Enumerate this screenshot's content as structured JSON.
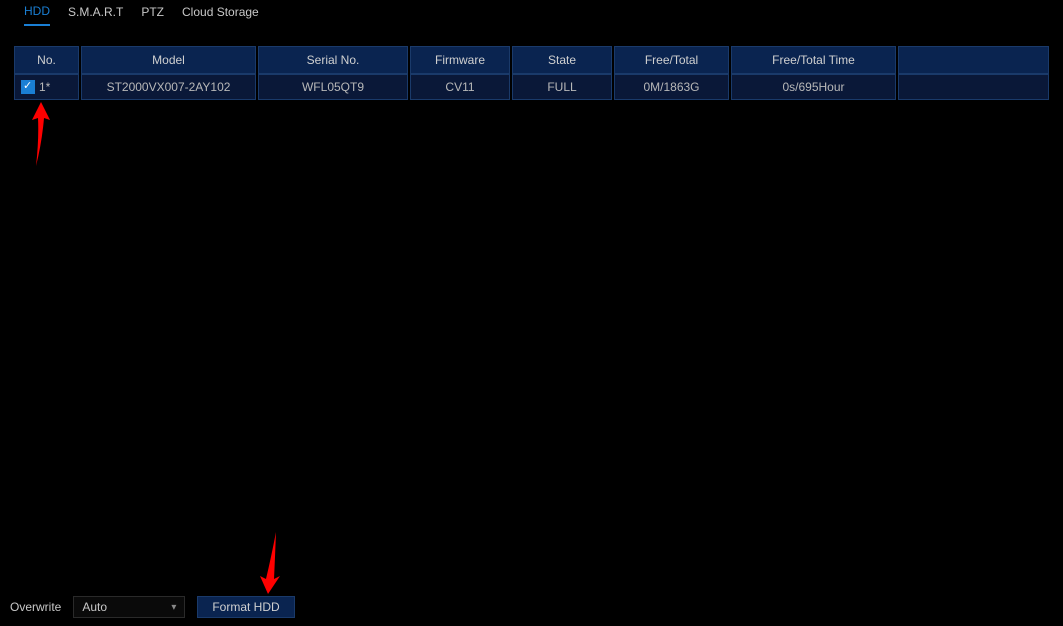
{
  "tabs": [
    {
      "label": "HDD",
      "active": true
    },
    {
      "label": "S.M.A.R.T",
      "active": false
    },
    {
      "label": "PTZ",
      "active": false
    },
    {
      "label": "Cloud Storage",
      "active": false
    }
  ],
  "table": {
    "headers": {
      "no": "No.",
      "model": "Model",
      "serial": "Serial No.",
      "firmware": "Firmware",
      "state": "State",
      "free_total": "Free/Total",
      "free_total_time": "Free/Total Time",
      "empty": ""
    },
    "rows": [
      {
        "checked": true,
        "no": "1*",
        "model": "ST2000VX007-2AY102",
        "serial": "WFL05QT9",
        "firmware": "CV11",
        "state": "FULL",
        "free_total": "0M/1863G",
        "free_total_time": "0s/695Hour"
      }
    ]
  },
  "bottom": {
    "overwrite_label": "Overwrite",
    "overwrite_value": "Auto",
    "format_label": "Format HDD"
  }
}
